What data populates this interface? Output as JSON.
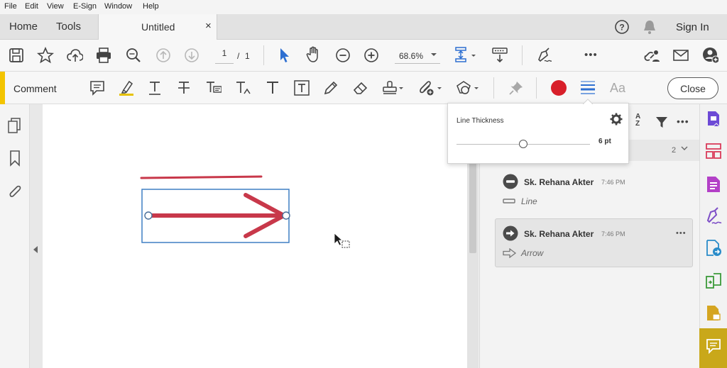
{
  "menubar": {
    "items": [
      "File",
      "Edit",
      "View",
      "E-Sign",
      "Window",
      "Help"
    ]
  },
  "tabs": {
    "home": "Home",
    "tools": "Tools",
    "document": "Untitled",
    "close_symbol": "×",
    "sign_in": "Sign In"
  },
  "toolbar": {
    "page_current": "1",
    "page_separator": "/",
    "page_total": "1",
    "zoom": "68.6%",
    "more": "•••"
  },
  "comment_bar": {
    "label": "Comment",
    "font_tool": "Aa",
    "close_label": "Close",
    "color_selected": "#d81f2a"
  },
  "popup": {
    "title": "Line Thickness",
    "value": "6 pt",
    "slider_fraction": 0.5
  },
  "pane": {
    "count": "2",
    "sort_label": "A Z",
    "more": "•••",
    "comments": [
      {
        "author": "Sk. Rehana Akter",
        "time": "7:46 PM",
        "type": "Line",
        "icon": "line-annotation-icon"
      },
      {
        "author": "Sk. Rehana Akter",
        "time": "7:46 PM",
        "type": "Arrow",
        "icon": "arrow-annotation-icon",
        "more": "•••"
      }
    ]
  },
  "canvas": {
    "line_color": "#c8384a",
    "arrow_color": "#c8384a",
    "selection_color": "#3f7fc4"
  },
  "colors": {
    "accent_yellow": "#f3c400",
    "blue_tool": "#2d6fd1",
    "purple_tool": "#9b3bc4"
  }
}
